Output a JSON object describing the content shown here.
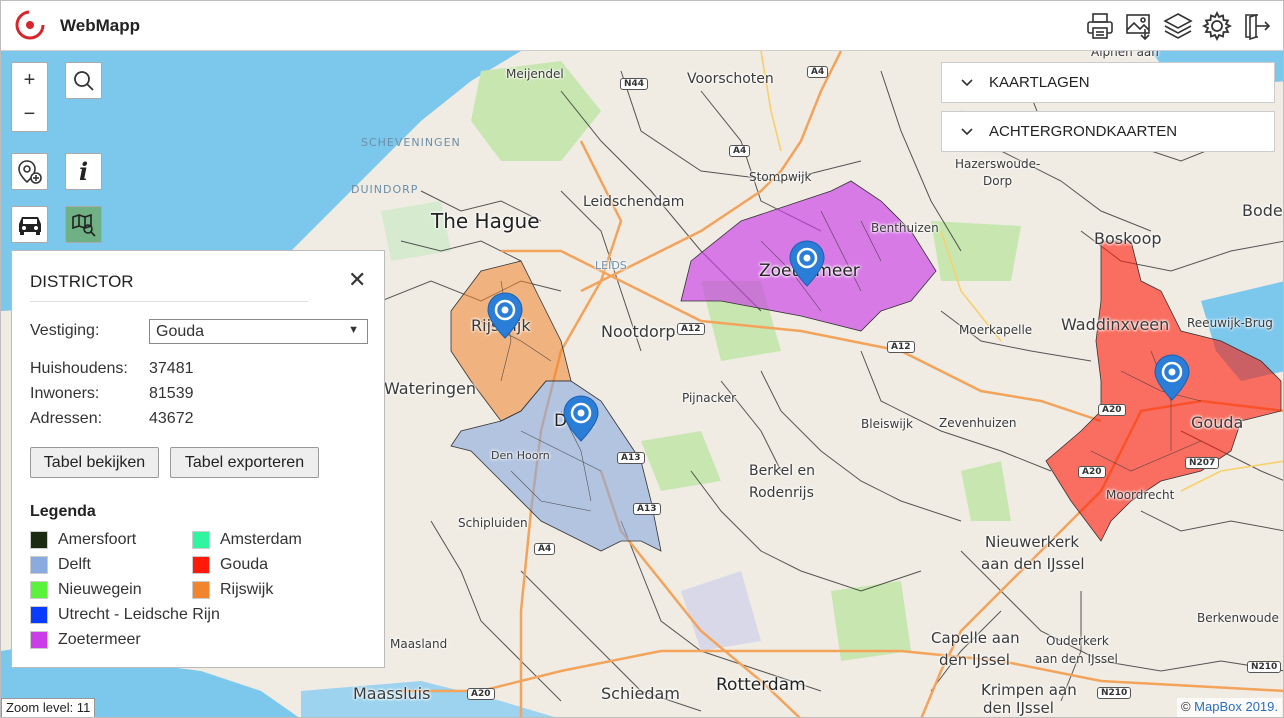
{
  "header": {
    "app_title": "WebMapp",
    "icons": [
      "print-icon",
      "image-export-icon",
      "layers-icon",
      "settings-icon",
      "logout-icon"
    ]
  },
  "controls": {
    "zoom_in": "+",
    "zoom_out": "−",
    "icons": [
      "search-icon",
      "add-location-icon",
      "info-icon",
      "car-icon",
      "map-search-icon"
    ]
  },
  "right_panels": {
    "layers": "KAARTLAGEN",
    "basemaps": "ACHTERGRONDKAARTEN"
  },
  "districtor": {
    "title": "DISTRICTOR",
    "close": "✕",
    "vestiging_label": "Vestiging:",
    "vestiging_value": "Gouda",
    "stats": [
      {
        "label": "Huishoudens:",
        "value": "37481"
      },
      {
        "label": "Inwoners:",
        "value": "81539"
      },
      {
        "label": "Adressen:",
        "value": "43672"
      }
    ],
    "btn_view": "Tabel bekijken",
    "btn_export": "Tabel exporteren",
    "legend_title": "Legenda",
    "legend": [
      {
        "label": "Amersfoort",
        "color": "#1b2a10"
      },
      {
        "label": "Amsterdam",
        "color": "#2df5a0"
      },
      {
        "label": "Delft",
        "color": "#8aaae0"
      },
      {
        "label": "Gouda",
        "color": "#ff1a0a"
      },
      {
        "label": "Nieuwegein",
        "color": "#5af23c"
      },
      {
        "label": "Rijswijk",
        "color": "#f0852d"
      },
      {
        "label": "Utrecht - Leidsche Rijn",
        "color": "#0a3cff"
      },
      {
        "label": "Zoetermeer",
        "color": "#c93ee6"
      }
    ]
  },
  "map_labels": {
    "the_hague": "The Hague",
    "rotterdam": "Rotterdam",
    "leidschendam": "Leidschendam",
    "voorschoten": "Voorschoten",
    "meijendel": "Meijendel",
    "scheveningen": "SCHEVENINGEN",
    "duindorp": "DUINDORP",
    "stompwijk": "Stompwijk",
    "zoetermeer": "Zoetermeer",
    "benthuizen": "Benthuizen",
    "hazerswoude": "Hazerswoude-",
    "dorp": "Dorp",
    "boskoop": "Boskoop",
    "bode": "Bode",
    "waddinxveen": "Waddinxveen",
    "reeuwijk": "Reeuwijk-Brug",
    "moerkapelle": "Moerkapelle",
    "nootdorp": "Nootdorp",
    "rijswijk": "Rijswijk",
    "wateringen": "Wateringen",
    "delft": "Delft",
    "pijnacker": "Pijnacker",
    "bleiswijk": "Bleiswijk",
    "zevenhuizen": "Zevenhuizen",
    "gouda": "Gouda",
    "moordrecht": "Moordrecht",
    "den_hoorn": "Den Hoorn",
    "berkel": "Berkel en",
    "rodenrijs": "Rodenrijs",
    "schipluiden": "Schipluiden",
    "nieuwerkerk": "Nieuwerkerk",
    "aan_den_ijssel": "aan den IJssel",
    "berkenwoude": "Berkenwoude",
    "capelle": "Capelle aan",
    "den_ijssel": "den IJssel",
    "ouderkerk": "Ouderkerk",
    "ouderkerk2": "aan den IJssel",
    "maasland": "Maasland",
    "maassluis": "Maassluis",
    "schiedam": "Schiedam",
    "krimpen": "Krimpen aan",
    "krimpen2": "den IJssel",
    "alphen": "Alphen aan",
    "leids": "LEIDS",
    "roads": [
      "N44",
      "A4",
      "A4",
      "A12",
      "A12",
      "A13",
      "A13",
      "A20",
      "A20",
      "N207",
      "A4",
      "N210",
      "N210",
      "A20"
    ]
  },
  "status": {
    "zoom_level": "Zoom level: 11",
    "attribution_prefix": "© ",
    "attribution_link": "MapBox 2019."
  }
}
